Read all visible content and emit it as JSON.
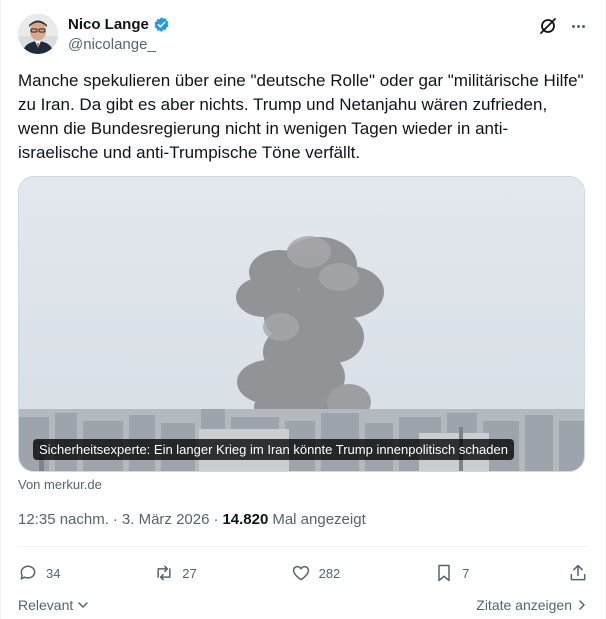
{
  "author": {
    "name": "Nico Lange",
    "handle": "@nicolange_"
  },
  "tweet": {
    "text": "Manche spekulieren über eine \"deutsche Rolle\" oder gar \"militärische Hilfe\" zu Iran. Da gibt es aber nichts. Trump und Netanjahu wären zufrieden, wenn die Bundesregierung nicht in wenigen Tagen wieder in anti-israelische und anti-Trumpische Töne verfällt."
  },
  "card": {
    "title": "Sicherheitsexperte: Ein langer Krieg im Iran könnte Trump innenpolitisch schaden",
    "source": "Von merkur.de"
  },
  "meta": {
    "time": "12:35 nachm.",
    "dot": "·",
    "date": "3. März 2026",
    "views_count": "14.820",
    "views_label": "Mal angezeigt"
  },
  "actions": {
    "replies": "34",
    "reposts": "27",
    "likes": "282",
    "bookmarks": "7"
  },
  "footer": {
    "sort_label": "Relevant",
    "quotes_label": "Zitate anzeigen"
  },
  "colors": {
    "verified_blue": "#1d9bf0",
    "text_primary": "#0f1419",
    "text_secondary": "#536471"
  }
}
